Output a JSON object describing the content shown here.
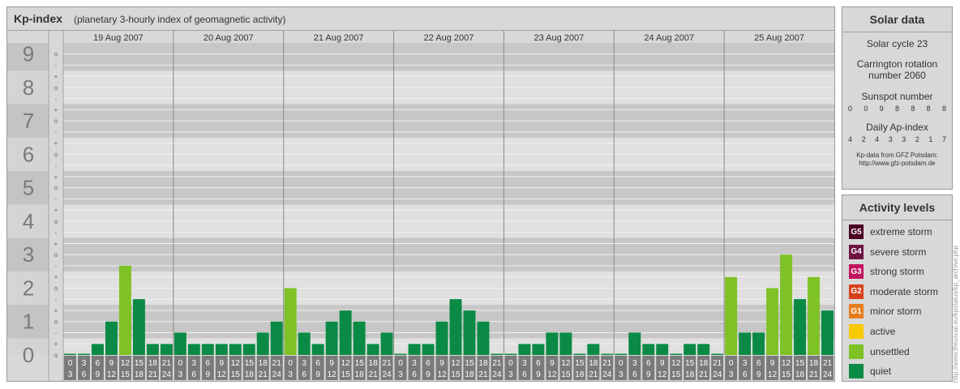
{
  "header": {
    "title": "Kp-index",
    "subtitle": "(planetary 3-hourly index of geomagnetic activity)"
  },
  "chart_data": {
    "type": "bar",
    "title": "Kp-index",
    "subtitle": "(planetary 3-hourly index of geomagnetic activity)",
    "days": [
      "19 Aug 2007",
      "20 Aug 2007",
      "21 Aug 2007",
      "22 Aug 2007",
      "23 Aug 2007",
      "24 Aug 2007",
      "25 Aug 2007"
    ],
    "interval_starts": [
      "0",
      "3",
      "6",
      "9",
      "12",
      "15",
      "18",
      "21"
    ],
    "interval_ends": [
      "3",
      "6",
      "9",
      "12",
      "15",
      "18",
      "21",
      "24"
    ],
    "sublevel_marks": [
      "o",
      "-",
      "+"
    ],
    "y_ticks": [
      "0",
      "1",
      "2",
      "3",
      "4",
      "5",
      "6",
      "7",
      "8",
      "9"
    ],
    "ylim": [
      0,
      9.33
    ],
    "values": [
      [
        0,
        0,
        0.33,
        1,
        2.67,
        1.67,
        0.33,
        0.33
      ],
      [
        0.67,
        0.33,
        0.33,
        0.33,
        0.33,
        0.33,
        0.67,
        1
      ],
      [
        2,
        0.67,
        0.33,
        1,
        1.33,
        1,
        0.33,
        0.67
      ],
      [
        0,
        0.33,
        0.33,
        1,
        1.67,
        1.33,
        1,
        0
      ],
      [
        0,
        0.33,
        0.33,
        0.67,
        0.67,
        0,
        0.33,
        0
      ],
      [
        0,
        0.67,
        0.33,
        0.33,
        0,
        0.33,
        0.33,
        0
      ],
      [
        2.33,
        0.67,
        0.67,
        2,
        3,
        1.67,
        2.33,
        1.33
      ]
    ],
    "level_colors": {
      "quiet": "#0b8a45",
      "unsettled": "#7ec226",
      "active": "#f8c800",
      "minor": "#e67e1e",
      "moderate": "#d9401c",
      "strong": "#c0135e",
      "severe": "#6d1242",
      "extreme": "#4a0022"
    },
    "grid": true
  },
  "solar": {
    "title": "Solar data",
    "cycle": "Solar cycle 23",
    "rotation_line1": "Carrington rotation",
    "rotation_line2": "number 2060",
    "sunspot_label": "Sunspot number",
    "sunspot_values": [
      "0",
      "0",
      "9",
      "8",
      "8",
      "8",
      "8"
    ],
    "ap_label": "Daily Ap-index",
    "ap_values": [
      "4",
      "2",
      "4",
      "3",
      "3",
      "2",
      "1",
      "7"
    ],
    "credit_line1": "Kp-data from GFZ Potsdam:",
    "credit_line2": "http://www.gfz-potsdam.de"
  },
  "activity": {
    "title": "Activity levels",
    "levels": [
      {
        "badge": "G5",
        "label": "extreme storm",
        "color": "#4a0022"
      },
      {
        "badge": "G4",
        "label": "severe storm",
        "color": "#6d1242"
      },
      {
        "badge": "G3",
        "label": "strong storm",
        "color": "#c0135e"
      },
      {
        "badge": "G2",
        "label": "moderate storm",
        "color": "#d9401c"
      },
      {
        "badge": "G1",
        "label": "minor storm",
        "color": "#e67e1e"
      },
      {
        "badge": "",
        "label": "active",
        "color": "#f8c800"
      },
      {
        "badge": "",
        "label": "unsettled",
        "color": "#7ec226"
      },
      {
        "badge": "",
        "label": "quiet",
        "color": "#0b8a45"
      }
    ]
  },
  "side_credit": "http://www.theusual.eu/kpstatus/kp_archive.php"
}
